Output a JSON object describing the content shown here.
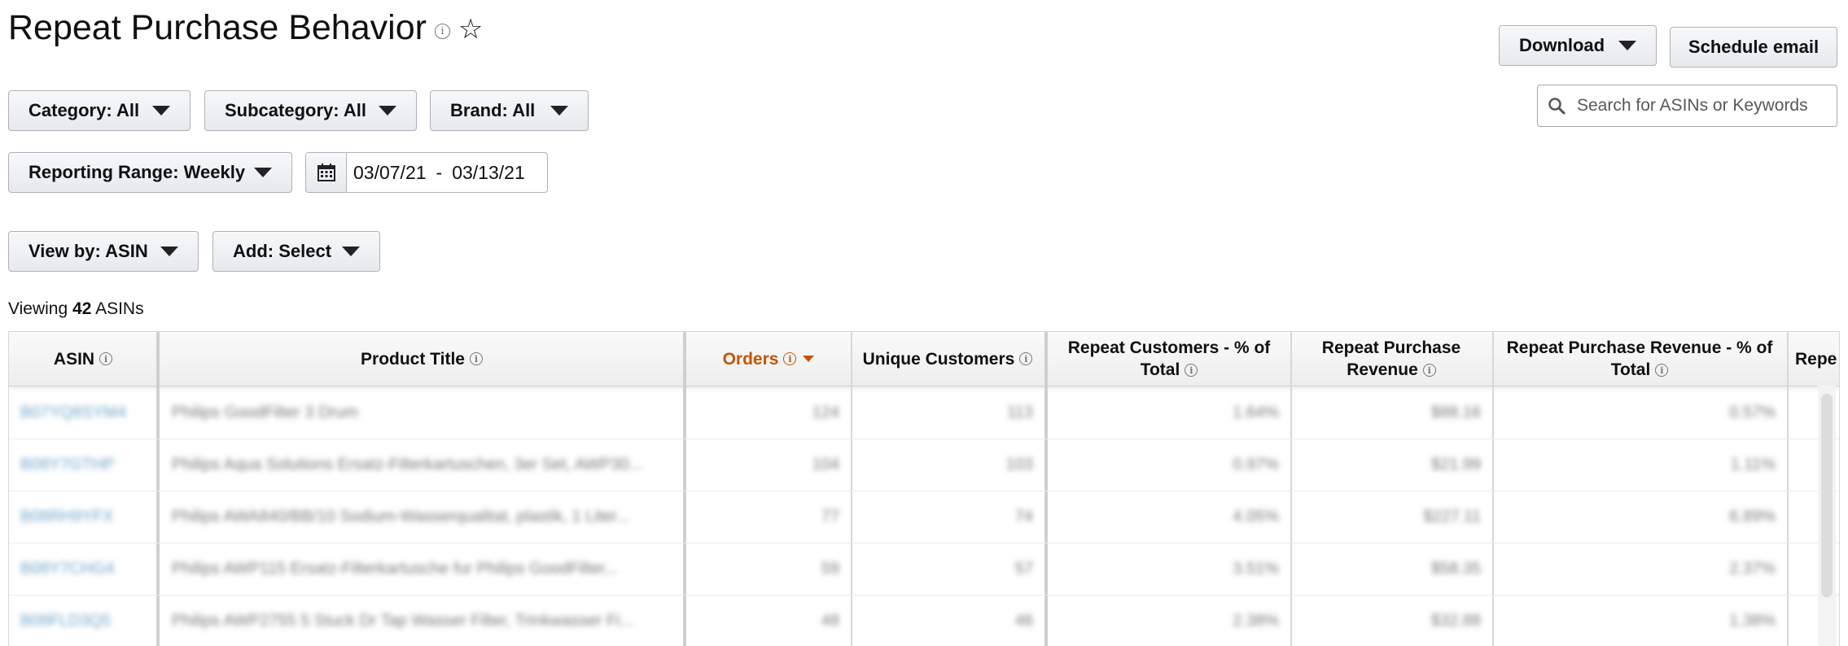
{
  "page": {
    "title": "Repeat Purchase Behavior"
  },
  "toolbar": {
    "download_label": "Download",
    "schedule_label": "Schedule email",
    "search_placeholder": "Search for ASINs or Keywords"
  },
  "filters": {
    "category": "Category: All",
    "subcategory": "Subcategory: All",
    "brand": "Brand: All",
    "reporting_range": "Reporting Range: Weekly",
    "date_start": "03/07/21",
    "date_separator": "-",
    "date_end": "03/13/21",
    "view_by": "View by: ASIN",
    "add": "Add: Select"
  },
  "summary": {
    "prefix": "Viewing",
    "count": "42",
    "suffix": "ASINs"
  },
  "table": {
    "columns": [
      {
        "label": "ASIN"
      },
      {
        "label": "Product Title"
      },
      {
        "label": "Orders"
      },
      {
        "label": "Unique Customers"
      },
      {
        "label": "Repeat Customers - % of Total"
      },
      {
        "label": "Repeat Purchase Revenue"
      },
      {
        "label": "Repeat Purchase Revenue - % of Total"
      },
      {
        "label": "Repe"
      }
    ],
    "rows": [
      {
        "asin": "B07YQ8SYM4",
        "title": "Philips GoodFilter 3 Drum",
        "orders": "124",
        "customers": "113",
        "repeat_pct": "1.64%",
        "revenue": "$88.16",
        "revenue_pct": "0.57%"
      },
      {
        "asin": "B08Y7GTHP",
        "title": "Philips Aqua Solutions Ersatz-Filterkartuschen, 3er Set, AWP30...",
        "orders": "104",
        "customers": "103",
        "repeat_pct": "0.97%",
        "revenue": "$21.99",
        "revenue_pct": "1.11%"
      },
      {
        "asin": "B08RH9YFX",
        "title": "Philips AWA840/BB/10 Sodium-Wasserqualitat, plastik, 1 Liter...",
        "orders": "77",
        "customers": "74",
        "repeat_pct": "4.05%",
        "revenue": "$227.11",
        "revenue_pct": "6.89%"
      },
      {
        "asin": "B08Y7CHG4",
        "title": "Philips AWP115 Ersatz-Filterkartusche fur Philips GoodFilter...",
        "orders": "59",
        "customers": "57",
        "repeat_pct": "3.51%",
        "revenue": "$58.35",
        "revenue_pct": "2.37%"
      },
      {
        "asin": "B08FLD3Q5",
        "title": "Philips AWP2755 5 Stuck Dr Tap Wasser Filter, Trinkwasser Fi...",
        "orders": "48",
        "customers": "46",
        "repeat_pct": "2.38%",
        "revenue": "$32.88",
        "revenue_pct": "1.38%"
      }
    ]
  },
  "colors": {
    "sorted_column": "#c45500",
    "link": "#007185"
  }
}
